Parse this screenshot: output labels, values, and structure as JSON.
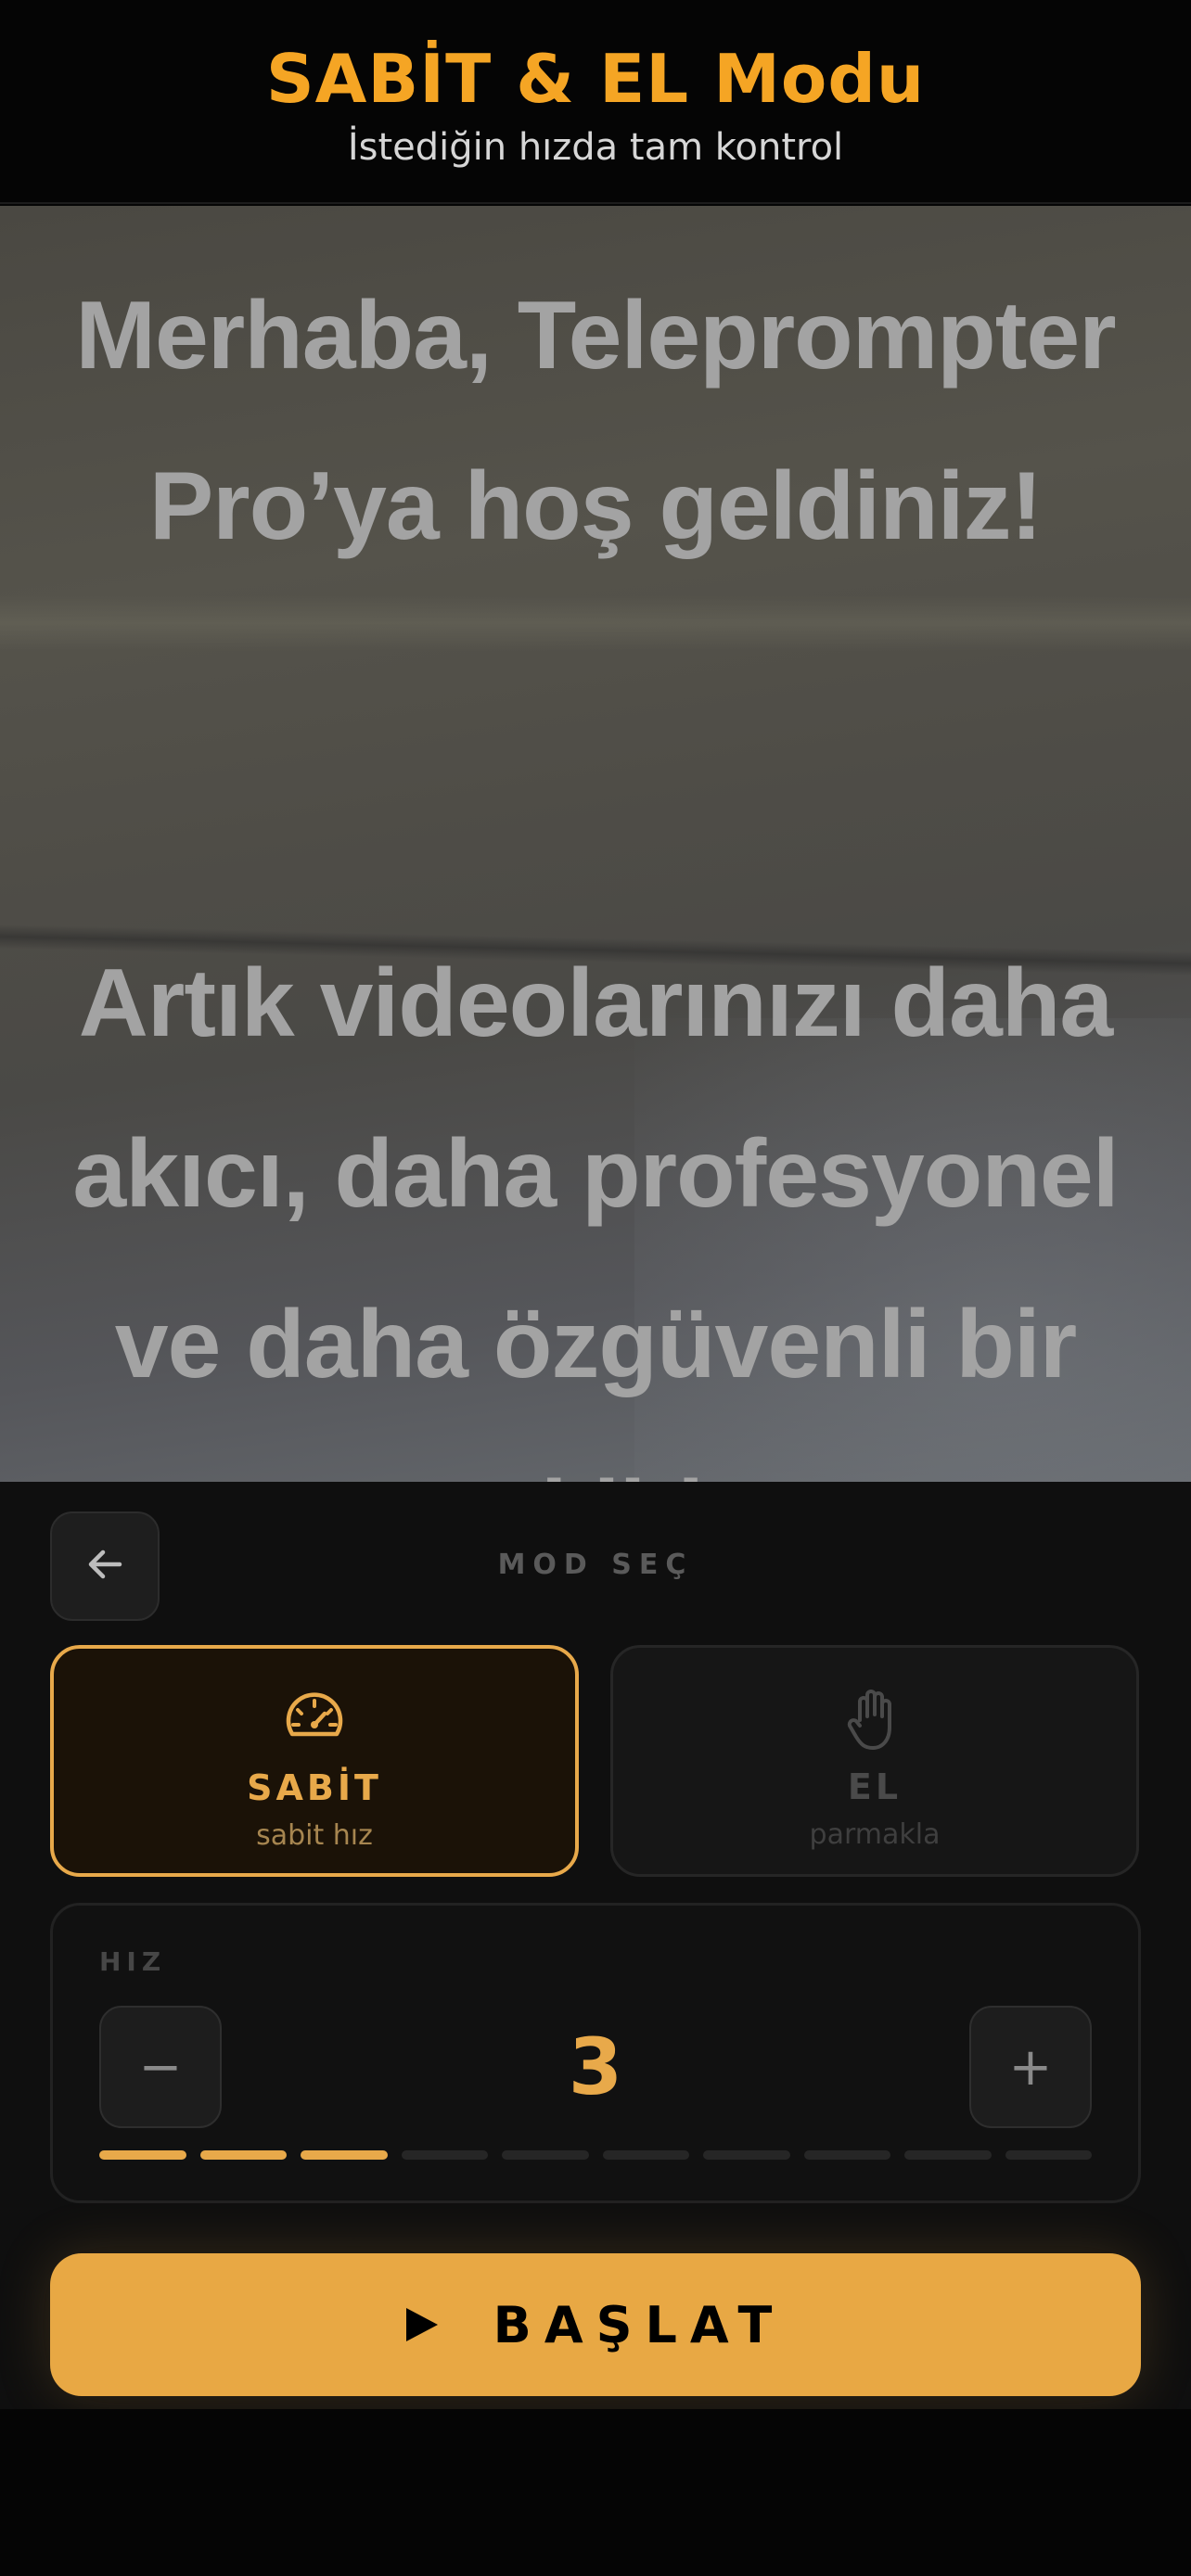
{
  "header": {
    "title": "SABİT & EL Modu",
    "subtitle": "İstediğin hızda tam kontrol"
  },
  "prompter": {
    "paragraphs": [
      "Merhaba, Teleprompter Pro’ya hoş geldiniz!",
      "Artık videolarınızı daha akıcı, daha profesyonel ve daha özgüvenli bir şekilde"
    ]
  },
  "panel": {
    "back_icon": "arrow-left-icon",
    "mode_label": "MOD SEÇ",
    "modes": [
      {
        "name": "SABİT",
        "desc": "sabit hız",
        "icon": "speedometer-icon",
        "selected": true
      },
      {
        "name": "EL",
        "desc": "parmakla",
        "icon": "hand-icon",
        "selected": false
      }
    ],
    "speed": {
      "label": "HIZ",
      "value": "3",
      "level": 3,
      "max": 10,
      "minus_label": "−",
      "plus_label": "+"
    },
    "start_label": "BAŞLAT",
    "start_icon": "play-icon"
  },
  "colors": {
    "accent": "#e8a94a",
    "title": "#f5a524",
    "background": "#050505",
    "panel": "#0f0f0f"
  }
}
